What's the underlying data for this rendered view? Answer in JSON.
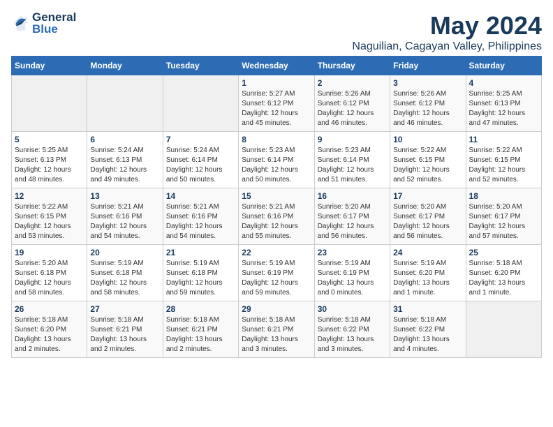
{
  "logo": {
    "general": "General",
    "blue": "Blue"
  },
  "title": "May 2024",
  "subtitle": "Naguilian, Cagayan Valley, Philippines",
  "days_header": [
    "Sunday",
    "Monday",
    "Tuesday",
    "Wednesday",
    "Thursday",
    "Friday",
    "Saturday"
  ],
  "weeks": [
    [
      {
        "num": "",
        "info": ""
      },
      {
        "num": "",
        "info": ""
      },
      {
        "num": "",
        "info": ""
      },
      {
        "num": "1",
        "info": "Sunrise: 5:27 AM\nSunset: 6:12 PM\nDaylight: 12 hours\nand 45 minutes."
      },
      {
        "num": "2",
        "info": "Sunrise: 5:26 AM\nSunset: 6:12 PM\nDaylight: 12 hours\nand 46 minutes."
      },
      {
        "num": "3",
        "info": "Sunrise: 5:26 AM\nSunset: 6:12 PM\nDaylight: 12 hours\nand 46 minutes."
      },
      {
        "num": "4",
        "info": "Sunrise: 5:25 AM\nSunset: 6:13 PM\nDaylight: 12 hours\nand 47 minutes."
      }
    ],
    [
      {
        "num": "5",
        "info": "Sunrise: 5:25 AM\nSunset: 6:13 PM\nDaylight: 12 hours\nand 48 minutes."
      },
      {
        "num": "6",
        "info": "Sunrise: 5:24 AM\nSunset: 6:13 PM\nDaylight: 12 hours\nand 49 minutes."
      },
      {
        "num": "7",
        "info": "Sunrise: 5:24 AM\nSunset: 6:14 PM\nDaylight: 12 hours\nand 50 minutes."
      },
      {
        "num": "8",
        "info": "Sunrise: 5:23 AM\nSunset: 6:14 PM\nDaylight: 12 hours\nand 50 minutes."
      },
      {
        "num": "9",
        "info": "Sunrise: 5:23 AM\nSunset: 6:14 PM\nDaylight: 12 hours\nand 51 minutes."
      },
      {
        "num": "10",
        "info": "Sunrise: 5:22 AM\nSunset: 6:15 PM\nDaylight: 12 hours\nand 52 minutes."
      },
      {
        "num": "11",
        "info": "Sunrise: 5:22 AM\nSunset: 6:15 PM\nDaylight: 12 hours\nand 52 minutes."
      }
    ],
    [
      {
        "num": "12",
        "info": "Sunrise: 5:22 AM\nSunset: 6:15 PM\nDaylight: 12 hours\nand 53 minutes."
      },
      {
        "num": "13",
        "info": "Sunrise: 5:21 AM\nSunset: 6:16 PM\nDaylight: 12 hours\nand 54 minutes."
      },
      {
        "num": "14",
        "info": "Sunrise: 5:21 AM\nSunset: 6:16 PM\nDaylight: 12 hours\nand 54 minutes."
      },
      {
        "num": "15",
        "info": "Sunrise: 5:21 AM\nSunset: 6:16 PM\nDaylight: 12 hours\nand 55 minutes."
      },
      {
        "num": "16",
        "info": "Sunrise: 5:20 AM\nSunset: 6:17 PM\nDaylight: 12 hours\nand 56 minutes."
      },
      {
        "num": "17",
        "info": "Sunrise: 5:20 AM\nSunset: 6:17 PM\nDaylight: 12 hours\nand 56 minutes."
      },
      {
        "num": "18",
        "info": "Sunrise: 5:20 AM\nSunset: 6:17 PM\nDaylight: 12 hours\nand 57 minutes."
      }
    ],
    [
      {
        "num": "19",
        "info": "Sunrise: 5:20 AM\nSunset: 6:18 PM\nDaylight: 12 hours\nand 58 minutes."
      },
      {
        "num": "20",
        "info": "Sunrise: 5:19 AM\nSunset: 6:18 PM\nDaylight: 12 hours\nand 58 minutes."
      },
      {
        "num": "21",
        "info": "Sunrise: 5:19 AM\nSunset: 6:18 PM\nDaylight: 12 hours\nand 59 minutes."
      },
      {
        "num": "22",
        "info": "Sunrise: 5:19 AM\nSunset: 6:19 PM\nDaylight: 12 hours\nand 59 minutes."
      },
      {
        "num": "23",
        "info": "Sunrise: 5:19 AM\nSunset: 6:19 PM\nDaylight: 13 hours\nand 0 minutes."
      },
      {
        "num": "24",
        "info": "Sunrise: 5:19 AM\nSunset: 6:20 PM\nDaylight: 13 hours\nand 1 minute."
      },
      {
        "num": "25",
        "info": "Sunrise: 5:18 AM\nSunset: 6:20 PM\nDaylight: 13 hours\nand 1 minute."
      }
    ],
    [
      {
        "num": "26",
        "info": "Sunrise: 5:18 AM\nSunset: 6:20 PM\nDaylight: 13 hours\nand 2 minutes."
      },
      {
        "num": "27",
        "info": "Sunrise: 5:18 AM\nSunset: 6:21 PM\nDaylight: 13 hours\nand 2 minutes."
      },
      {
        "num": "28",
        "info": "Sunrise: 5:18 AM\nSunset: 6:21 PM\nDaylight: 13 hours\nand 2 minutes."
      },
      {
        "num": "29",
        "info": "Sunrise: 5:18 AM\nSunset: 6:21 PM\nDaylight: 13 hours\nand 3 minutes."
      },
      {
        "num": "30",
        "info": "Sunrise: 5:18 AM\nSunset: 6:22 PM\nDaylight: 13 hours\nand 3 minutes."
      },
      {
        "num": "31",
        "info": "Sunrise: 5:18 AM\nSunset: 6:22 PM\nDaylight: 13 hours\nand 4 minutes."
      },
      {
        "num": "",
        "info": ""
      }
    ]
  ]
}
